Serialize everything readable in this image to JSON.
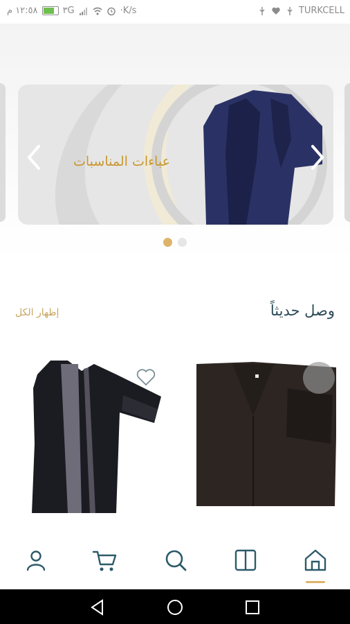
{
  "status_bar": {
    "time": "١٢:٥٨ م",
    "network_speed": "·K/s",
    "signal_label": "٣G",
    "carrier": "TURKCELL"
  },
  "banner": {
    "title": "عباءات المناسبات",
    "slide_count": 2,
    "active_slide": 1
  },
  "section": {
    "title": "وصل حديثاً",
    "show_all": "إظهار الكل"
  },
  "products": [
    {
      "name": "product-black-abaya-striped",
      "favorite_icon": "heart-outline-icon"
    },
    {
      "name": "product-brown-abaya",
      "favorite_icon": "circle-overlay"
    }
  ],
  "bottom_nav": {
    "items": [
      "profile-icon",
      "cart-icon",
      "search-icon",
      "categories-icon",
      "home-icon"
    ],
    "active": "home-icon"
  },
  "colors": {
    "accent": "#ddb46a",
    "gold_text": "#c8972f",
    "primary_text": "#2b4a58",
    "nav_icon": "#2b5a6a"
  }
}
